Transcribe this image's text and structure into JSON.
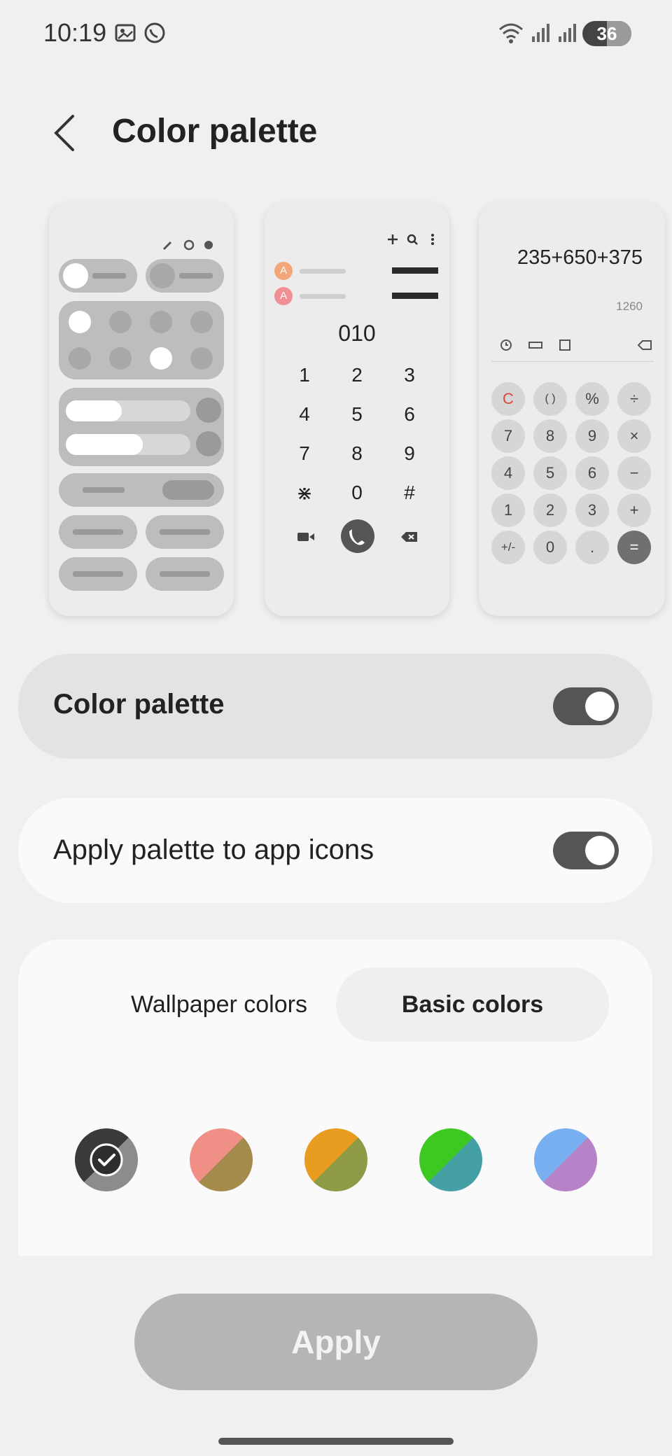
{
  "status_bar": {
    "time": "10:19",
    "battery": "36",
    "icons": [
      "screenshot-icon",
      "whatsapp-icon",
      "wifi-icon",
      "signal-icon",
      "signal-icon"
    ]
  },
  "header": {
    "title": "Color palette",
    "back_icon": "back-arrow-icon"
  },
  "previews": {
    "dialer": {
      "number": "010",
      "contact_initial": "A",
      "keys": [
        "1",
        "2",
        "3",
        "4",
        "5",
        "6",
        "7",
        "8",
        "9",
        "⋇",
        "0",
        "#"
      ]
    },
    "calculator": {
      "expression": "235+650+375",
      "result": "1260",
      "keys": [
        "C",
        "( )",
        "%",
        "÷",
        "7",
        "8",
        "9",
        "×",
        "4",
        "5",
        "6",
        "−",
        "1",
        "2",
        "3",
        "+",
        "+/-",
        "0",
        ".",
        "="
      ]
    }
  },
  "settings": {
    "color_palette_label": "Color palette",
    "color_palette_on": true,
    "apply_icons_label": "Apply palette to app icons",
    "apply_icons_on": true
  },
  "palette": {
    "tabs": [
      "Wallpaper colors",
      "Basic colors"
    ],
    "selected_tab": "Basic colors",
    "swatches": [
      {
        "a": "#3a3a3a",
        "b": "#8c8c8c",
        "selected": true
      },
      {
        "a": "#ef8f85",
        "b": "#a48a4b",
        "selected": false
      },
      {
        "a": "#e89d20",
        "b": "#8e9a45",
        "selected": false
      },
      {
        "a": "#3ec822",
        "b": "#44a0a4",
        "selected": false
      },
      {
        "a": "#78aff0",
        "b": "#b882c8",
        "selected": false
      }
    ]
  },
  "apply_button": "Apply"
}
